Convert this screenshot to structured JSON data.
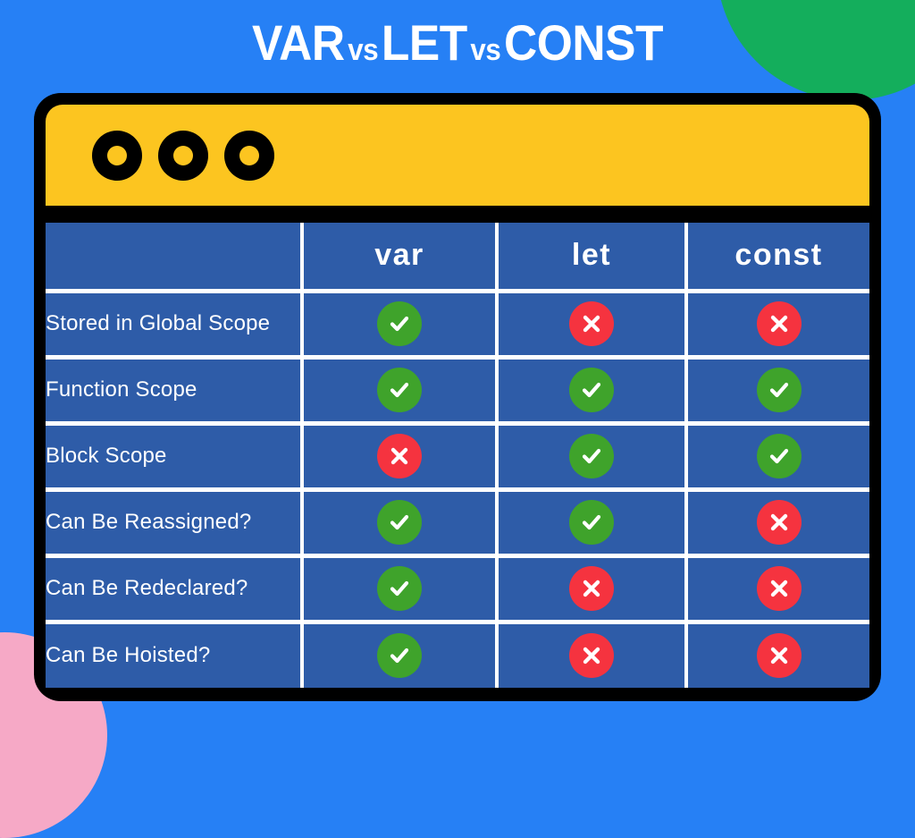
{
  "page": {
    "title_parts": [
      "VAR",
      "vs",
      "LET",
      "vs",
      "CONST"
    ],
    "title_full": "VAR vs LET vs CONST",
    "background_color": "#2680F5"
  },
  "decorations": [
    {
      "name": "green-circle",
      "color": "#14AE5C",
      "position": "top-right"
    },
    {
      "name": "pink-circle",
      "color": "#F6A9C6",
      "position": "bottom-left"
    }
  ],
  "browser_window": {
    "frame_color": "#000000",
    "titlebar_color": "#FCC520",
    "dots": [
      "dot-one",
      "dot-two",
      "dot-three"
    ]
  },
  "table": {
    "cell_color": "#2E5CA8",
    "divider_color": "#FFFFFF",
    "headers": [
      "",
      "var",
      "let",
      "const"
    ],
    "yes_color": "#3FA32B",
    "no_color": "#F5333F",
    "rows": [
      {
        "label": "Stored in Global Scope",
        "var": "yes",
        "let": "no",
        "const": "no"
      },
      {
        "label": "Function Scope",
        "var": "yes",
        "let": "yes",
        "const": "yes"
      },
      {
        "label": "Block Scope",
        "var": "no",
        "let": "yes",
        "const": "yes"
      },
      {
        "label": "Can Be Reassigned?",
        "var": "yes",
        "let": "yes",
        "const": "no"
      },
      {
        "label": "Can Be Redeclared?",
        "var": "yes",
        "let": "no",
        "const": "no"
      },
      {
        "label": "Can Be Hoisted?",
        "var": "yes",
        "let": "no",
        "const": "no"
      }
    ]
  }
}
